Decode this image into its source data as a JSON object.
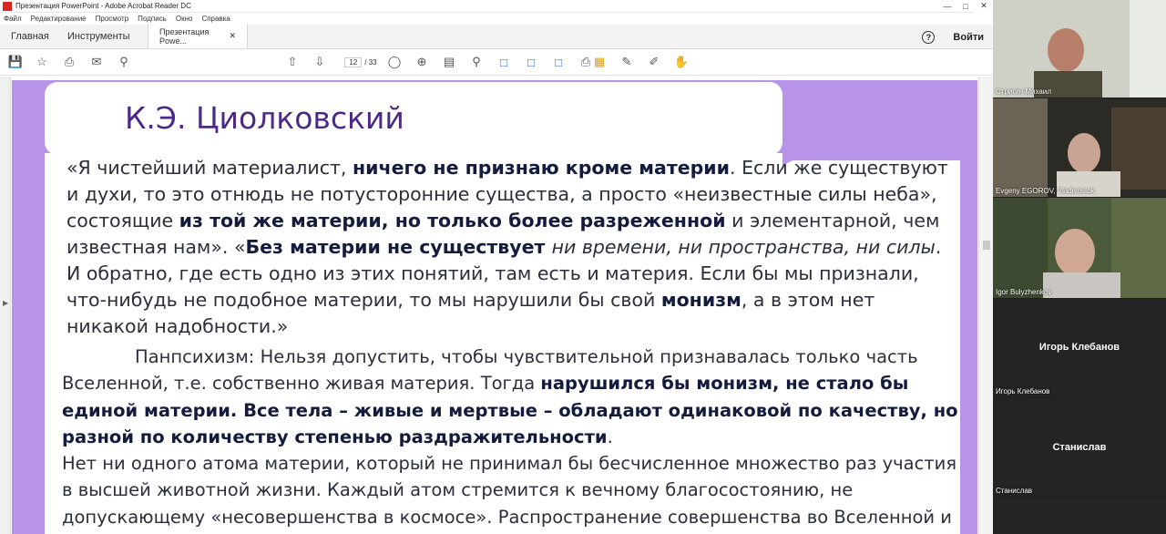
{
  "window": {
    "title": "Презентация PowerPoint - Adobe Acrobat Reader DC"
  },
  "menu": [
    "Файл",
    "Редактирование",
    "Просмотр",
    "Подпись",
    "Окно",
    "Справка"
  ],
  "tabs": {
    "home": "Главная",
    "tools": "Инструменты",
    "document": "Презентация Powe..."
  },
  "header": {
    "signin": "Войти"
  },
  "toolbar": {
    "page_current": "12",
    "page_total": "/ 33"
  },
  "slide": {
    "title": "К.Э. Циолковский",
    "quote_segments": [
      {
        "t": "«Я чистейший материалист, ",
        "s": "n"
      },
      {
        "t": "ничего не признаю кроме материи",
        "s": "b"
      },
      {
        "t": ". Если же существуют и духи, то это отнюдь не потусторонние существа, а просто «неизвестные силы неба», состоящие ",
        "s": "n"
      },
      {
        "t": "из той же материи, но только более разреженной",
        "s": "b"
      },
      {
        "t": " и элементарной, чем известная нам». «",
        "s": "n"
      },
      {
        "t": "Без материи не существует ",
        "s": "b"
      },
      {
        "t": "ни времени, ни пространства, ни силы",
        "s": "i"
      },
      {
        "t": ". И обратно, где есть одно из этих понятий, там есть и материя. Если бы мы признали, что-нибудь не подобное материи, то мы нарушили бы свой ",
        "s": "n"
      },
      {
        "t": "монизм",
        "s": "b"
      },
      {
        "t": ", а в этом нет никакой надобности.»",
        "s": "n"
      }
    ],
    "para_segments": [
      {
        "t": "Панпсихизм: Нельзя допустить, чтобы чувствительной признавалась только часть Вселенной, т.е. собственно живая материя. Тогда ",
        "s": "n"
      },
      {
        "t": "нарушился бы монизм, не стало бы единой материи. Все тела – живые и мертвые – обладают одинаковой по качеству, но разной по количеству степенью раздражительности",
        "s": "b"
      },
      {
        "t": ".",
        "s": "n"
      }
    ],
    "para3": "Нет ни одного атома материи, который не принимал бы бесчисленное множество раз участия в высшей животной жизни. Каждый атом стремится к вечному благосостоянию, не допускающему «несовершенства в космосе». Распространение совершенства во Вселенной и"
  },
  "participants": [
    {
      "name": "Стригин Михаил",
      "kind": "video"
    },
    {
      "name": "Evgeny EGOROV, Vladivostok",
      "kind": "video"
    },
    {
      "name": "Igor Bulyzhenkov",
      "kind": "video"
    },
    {
      "name": "Игорь Клебанов",
      "kind": "audio",
      "center_label": "Игорь Клебанов"
    },
    {
      "name": "Станислав",
      "kind": "audio",
      "center_label": "Станислав"
    }
  ],
  "colors": {
    "slide_background": "#b894e8",
    "title": "#4b2a86",
    "accent_blue": "#1b6fce"
  }
}
